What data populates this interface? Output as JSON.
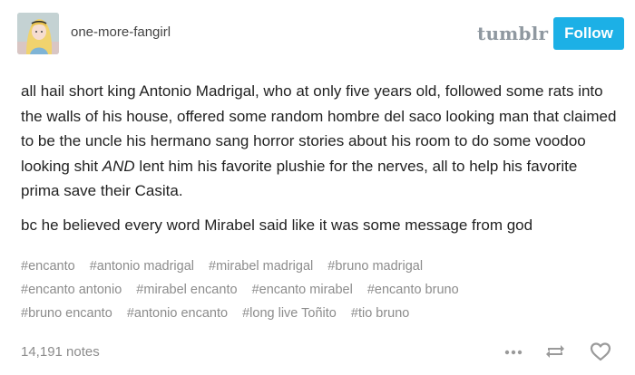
{
  "header": {
    "username": "one-more-fangirl",
    "logo": "tumblr",
    "follow_label": "Follow",
    "avatar_icon": "avatar-alice-icon"
  },
  "post": {
    "paragraph1_before": "all hail short king Antonio Madrigal, who at only five years old, followed some rats into the walls of his house, offered some random hombre del saco looking man that claimed to be the uncle his hermano sang horror stories about his room to do some voodoo looking shit ",
    "paragraph1_emph": "AND",
    "paragraph1_after": " lent him his favorite plushie for the nerves, all to help his favorite prima save their Casita.",
    "paragraph2": "bc he believed every word Mirabel said like it was some message from god"
  },
  "tags": [
    "#encanto",
    "#antonio madrigal",
    "#mirabel madrigal",
    "#bruno madrigal",
    "#encanto antonio",
    "#mirabel encanto",
    "#encanto mirabel",
    "#encanto bruno",
    "#bruno encanto",
    "#antonio encanto",
    "#long live Toñito",
    "#tio bruno"
  ],
  "footer": {
    "notes": "14,191 notes",
    "icons": [
      "more-icon",
      "reblog-icon",
      "heart-icon"
    ]
  },
  "colors": {
    "accent": "#1cb0e6",
    "logo": "#8f98a0",
    "muted": "#8c8c8c",
    "text": "#222222"
  }
}
